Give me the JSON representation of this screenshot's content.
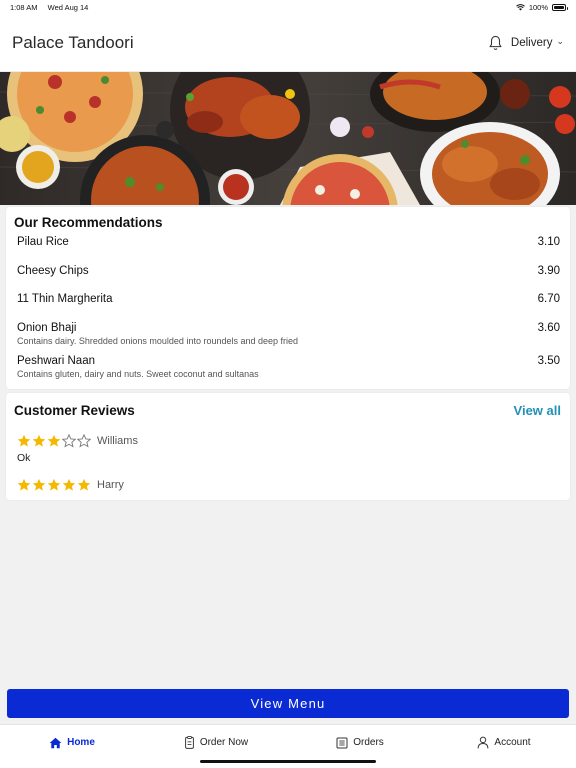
{
  "status": {
    "time": "1:08 AM",
    "date": "Wed Aug 14",
    "battery": "100%"
  },
  "header": {
    "title": "Palace Tandoori",
    "mode": "Delivery"
  },
  "recommendations": {
    "title": "Our Recommendations",
    "items": [
      {
        "name": "Pilau Rice",
        "desc": "",
        "price": "3.10"
      },
      {
        "name": "Cheesy Chips",
        "desc": "",
        "price": "3.90"
      },
      {
        "name": "11 Thin Margherita",
        "desc": "",
        "price": "6.70"
      },
      {
        "name": "Onion Bhaji",
        "desc": "Contains dairy. Shredded onions moulded into roundels and deep fried",
        "price": "3.60"
      },
      {
        "name": "Peshwari Naan",
        "desc": "Contains gluten, dairy and nuts. Sweet coconut and sultanas",
        "price": "3.50"
      }
    ]
  },
  "reviews": {
    "title": "Customer Reviews",
    "view_all": "View all",
    "items": [
      {
        "name": "Williams",
        "rating": 3,
        "text": "Ok"
      },
      {
        "name": "Harry",
        "rating": 5,
        "text": ""
      }
    ]
  },
  "view_menu": "View Menu",
  "tabs": [
    {
      "label": "Home",
      "icon": "home-icon",
      "active": true
    },
    {
      "label": "Order Now",
      "icon": "order-icon",
      "active": false
    },
    {
      "label": "Orders",
      "icon": "orders-list-icon",
      "active": false
    },
    {
      "label": "Account",
      "icon": "account-icon",
      "active": false
    }
  ],
  "colors": {
    "primary": "#0a2ad4",
    "link": "#2390b8",
    "star": "#f5b800"
  }
}
